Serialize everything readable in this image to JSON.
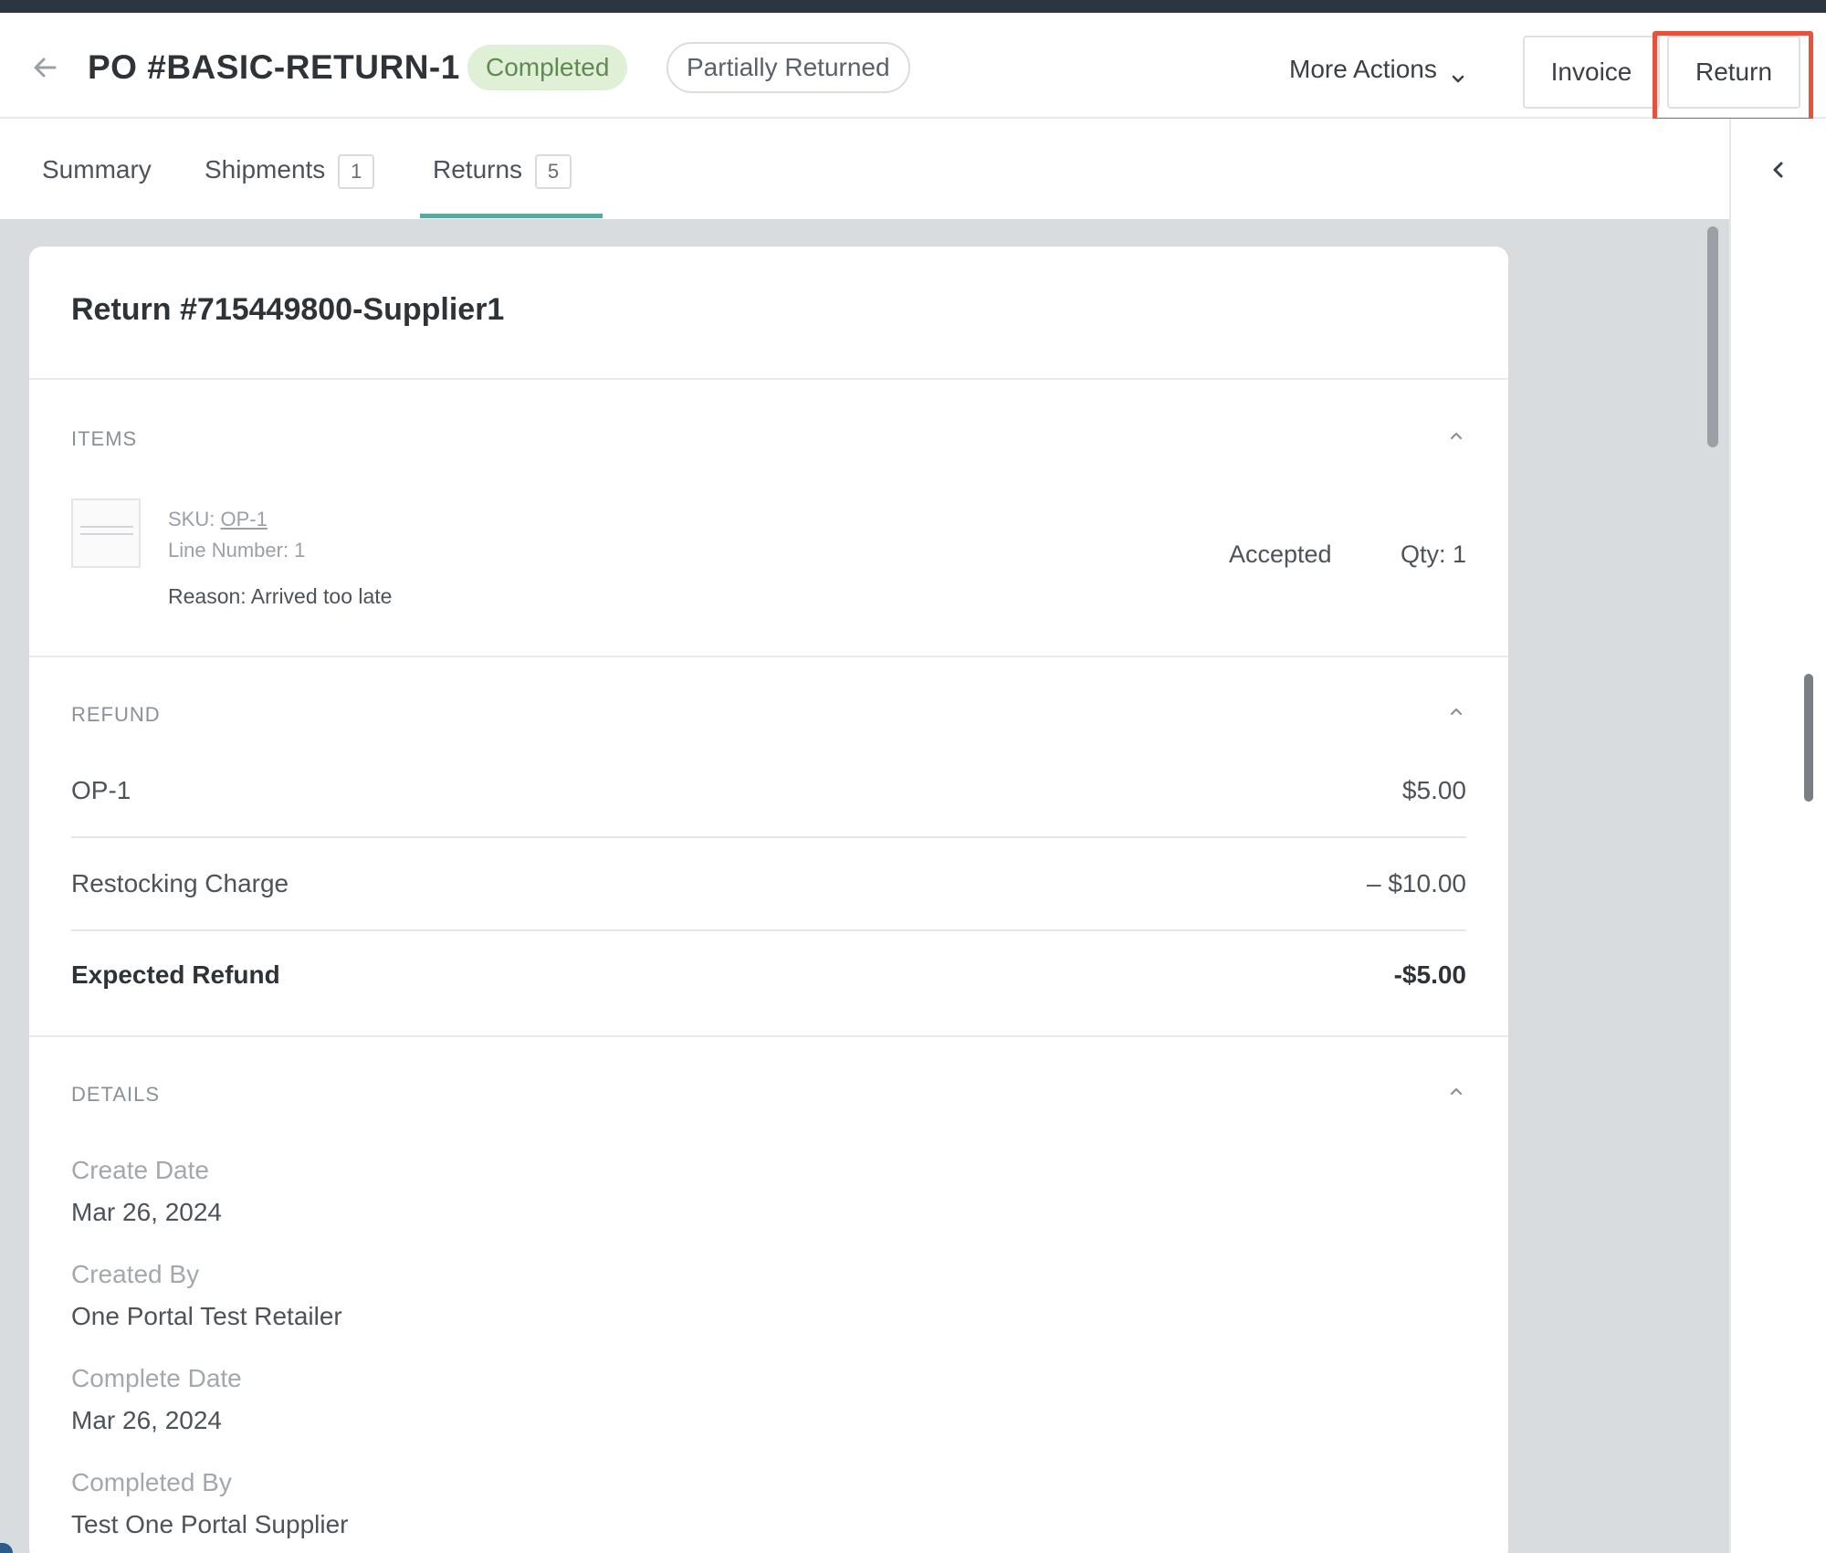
{
  "header": {
    "title": "PO #BASIC-RETURN-1",
    "status_badge": "Completed",
    "return_badge": "Partially Returned",
    "more_actions_label": "More Actions",
    "invoice_label": "Invoice",
    "return_label": "Return"
  },
  "tabs": [
    {
      "label": "Summary"
    },
    {
      "label": "Shipments",
      "count": "1"
    },
    {
      "label": "Returns",
      "count": "5",
      "active": true
    }
  ],
  "return_card": {
    "title": "Return #715449800-Supplier1",
    "items_section": {
      "label": "ITEMS",
      "item": {
        "sku_prefix": "SKU:",
        "sku": "OP-1",
        "line_number": "Line Number: 1",
        "reason": "Reason: Arrived too late",
        "status": "Accepted",
        "qty": "Qty: 1"
      }
    },
    "refund_section": {
      "label": "REFUND",
      "rows": [
        {
          "label": "OP-1",
          "value": "$5.00"
        },
        {
          "label": "Restocking Charge",
          "value": "– $10.00"
        },
        {
          "label": "Expected Refund",
          "value": "-$5.00"
        }
      ]
    },
    "details_section": {
      "label": "DETAILS",
      "fields": [
        {
          "label": "Create Date",
          "value": "Mar 26, 2024"
        },
        {
          "label": "Created By",
          "value": "One Portal Test Retailer"
        },
        {
          "label": "Complete Date",
          "value": "Mar 26, 2024"
        },
        {
          "label": "Completed By",
          "value": "Test One Portal Supplier"
        }
      ]
    }
  },
  "colors": {
    "accent_tab": "#5aa7a2",
    "completed_badge_bg": "#dff0d6",
    "highlight": "#e8513b"
  },
  "icons": {
    "back": "arrow-left-icon",
    "more_actions": "chevron-down-icon",
    "collapse_panel": "chevron-left-icon",
    "section_toggle": "chevron-up-icon"
  }
}
